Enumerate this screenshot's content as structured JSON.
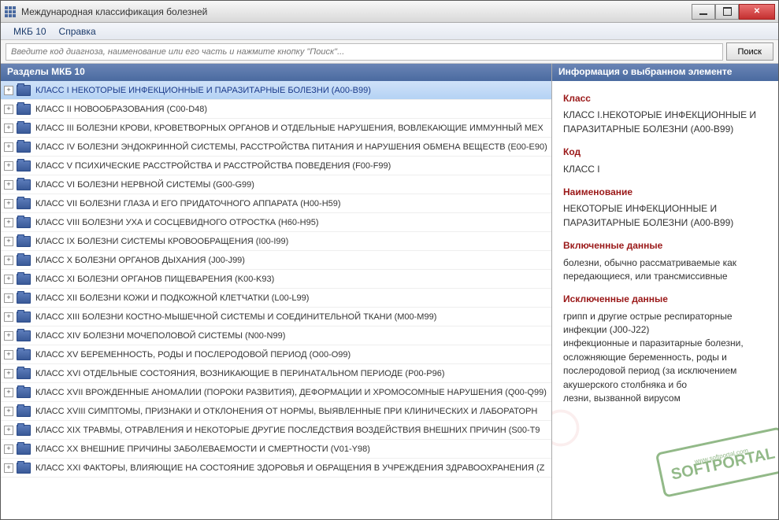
{
  "window": {
    "title": "Международная классификация болезней"
  },
  "menu": {
    "items": [
      "МКБ 10",
      "Справка"
    ]
  },
  "toolbar": {
    "search_placeholder": "Введите код диагноза, наименование или его часть и нажмите кнопку \"Поиск\"...",
    "search_button": "Поиск"
  },
  "left_panel": {
    "header": "Разделы МКБ 10",
    "tree": [
      {
        "label": "КЛАСС I НЕКОТОРЫЕ ИНФЕКЦИОННЫЕ И ПАРАЗИТАРНЫЕ БОЛЕЗНИ (A00-B99)",
        "selected": true
      },
      {
        "label": "КЛАСС II НОВООБРАЗОВАНИЯ (C00-D48)"
      },
      {
        "label": "КЛАСС III БОЛЕЗНИ КРОВИ, КРОВЕТВОРНЫХ ОРГАНОВ И ОТДЕЛЬНЫЕ НАРУШЕНИЯ, ВОВЛЕКАЮЩИЕ ИММУННЫЙ МЕХ"
      },
      {
        "label": "КЛАСС IV БОЛЕЗНИ ЭНДОКРИННОЙ СИСТЕМЫ, РАССТРОЙСТВА ПИТАНИЯ И НАРУШЕНИЯ ОБМЕНА ВЕЩЕСТВ (E00-E90)"
      },
      {
        "label": "КЛАСС V ПСИХИЧЕСКИЕ РАССТРОЙСТВА И РАССТРОЙСТВА ПОВЕДЕНИЯ (F00-F99)"
      },
      {
        "label": "КЛАСС VI БОЛЕЗНИ НЕРВНОЙ СИСТЕМЫ (G00-G99)"
      },
      {
        "label": "КЛАСС VII БОЛЕЗНИ ГЛАЗА И ЕГО ПРИДАТОЧНОГО АППАРАТА (H00-H59)"
      },
      {
        "label": "КЛАСС VIII БОЛЕЗНИ УХА И СОСЦЕВИДНОГО ОТРОСТКА (H60-H95)"
      },
      {
        "label": "КЛАСС IX БОЛЕЗНИ СИСТЕМЫ КРОВООБРАЩЕНИЯ (I00-I99)"
      },
      {
        "label": "КЛАСС X БОЛЕЗНИ ОРГАНОВ ДЫХАНИЯ (J00-J99)"
      },
      {
        "label": "КЛАСС XI БОЛЕЗНИ ОРГАНОВ ПИЩЕВАРЕНИЯ (K00-K93)"
      },
      {
        "label": "КЛАСС XII БОЛЕЗНИ КОЖИ И ПОДКОЖНОЙ КЛЕТЧАТКИ (L00-L99)"
      },
      {
        "label": "КЛАСС XIII БОЛЕЗНИ КОСТНО-МЫШЕЧНОЙ СИСТЕМЫ И СОЕДИНИТЕЛЬНОЙ ТКАНИ (M00-M99)"
      },
      {
        "label": "КЛАСС XIV БОЛЕЗНИ МОЧЕПОЛОВОЙ СИСТЕМЫ (N00-N99)"
      },
      {
        "label": "КЛАСС XV БЕРЕМЕННОСТЬ, РОДЫ И ПОСЛЕРОДОВОЙ ПЕРИОД (O00-O99)"
      },
      {
        "label": "КЛАСС XVI ОТДЕЛЬНЫЕ СОСТОЯНИЯ, ВОЗНИКАЮЩИЕ В ПЕРИНАТАЛЬНОМ ПЕРИОДЕ (P00-P96)"
      },
      {
        "label": "КЛАСС XVII ВРОЖДЕННЫЕ АНОМАЛИИ (ПОРОКИ РАЗВИТИЯ), ДЕФОРМАЦИИ И ХРОМОСОМНЫЕ НАРУШЕНИЯ (Q00-Q99)"
      },
      {
        "label": "КЛАСС XVIII СИМПТОМЫ, ПРИЗНАКИ И ОТКЛОНЕНИЯ ОТ НОРМЫ, ВЫЯВЛЕННЫЕ ПРИ КЛИНИЧЕСКИХ И ЛАБОРАТОРН"
      },
      {
        "label": "КЛАСС XIX ТРАВМЫ, ОТРАВЛЕНИЯ И НЕКОТОРЫЕ ДРУГИЕ ПОСЛЕДСТВИЯ ВОЗДЕЙСТВИЯ ВНЕШНИХ ПРИЧИН (S00-T9"
      },
      {
        "label": "КЛАСС XX ВНЕШНИЕ ПРИЧИНЫ ЗАБОЛЕВАЕМОСТИ И СМЕРТНОСТИ (V01-Y98)"
      },
      {
        "label": "КЛАСС XXI ФАКТОРЫ, ВЛИЯЮЩИЕ НА СОСТОЯНИЕ ЗДОРОВЬЯ И ОБРАЩЕНИЯ В УЧРЕЖДЕНИЯ ЗДРАВООХРАНЕНИЯ (Z"
      }
    ]
  },
  "right_panel": {
    "header": "Информация о выбранном элементе",
    "sections": {
      "class_label": "Класс",
      "class_value": "КЛАСС I.НЕКОТОРЫЕ ИНФЕКЦИОННЫЕ И ПАРАЗИТАРНЫЕ БОЛЕЗНИ (A00-B99)",
      "code_label": "Код",
      "code_value": "КЛАСС I",
      "name_label": "Наименование",
      "name_value": "НЕКОТОРЫЕ ИНФЕКЦИОННЫЕ И ПАРАЗИТАРНЫЕ БОЛЕЗНИ (A00-B99)",
      "included_label": "Включенные данные",
      "included_value": "болезни, обычно рассматриваемые как передающиеся, или трансмиссивные",
      "excluded_label": "Исключенные данные",
      "excluded_value": "грипп и другие острые респираторные инфекции (J00-J22)\nинфекционные и паразитарные болезни, осложняющие беременность, роды и послеродовой период (за исключением акушерского столбняка и бо\nлезни, вызванной вирусом"
    }
  },
  "watermark_text": "SOFTPORTAL"
}
